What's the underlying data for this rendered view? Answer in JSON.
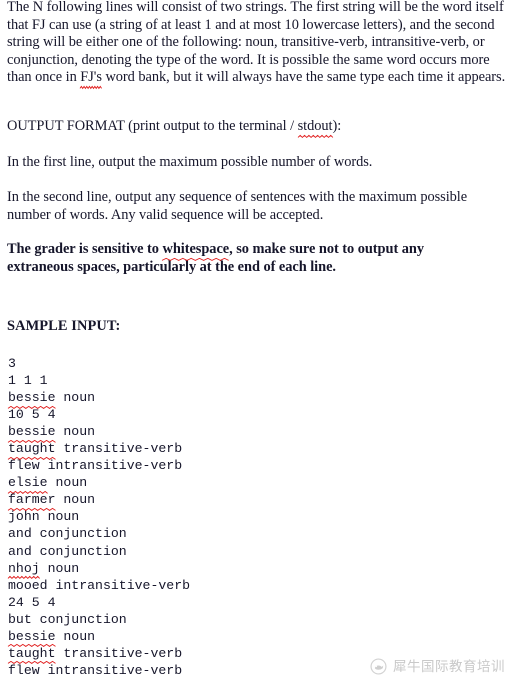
{
  "document": {
    "background_color": "#ffffff",
    "text_color": "#16162b",
    "spellcheck_underline_color": "#e01b1b"
  },
  "paragraphs": {
    "intro": {
      "part1": "The N following lines will consist of two strings.  The first string will be the word itself that FJ can use (a string of at least 1 and at most 10 lowercase letters), and the second string will be either one of the following: noun, transitive-verb, intransitive-verb, or conjunction, denoting the type of the word. It is possible the same word occurs more than once in ",
      "misspelled": "FJ's",
      "part2": " word bank, but it will always have the same type each time it appears."
    },
    "output_format": {
      "part1": "OUTPUT FORMAT (print output to the terminal / ",
      "misspelled": "stdout",
      "part2": "):"
    },
    "first_line": "In the first line, output the maximum possible number of words.",
    "second_line": "In the second line, output any sequence of sentences with the maximum possible number of words. Any valid sequence will be accepted.",
    "warning": {
      "part1": "The grader is sensitive to ",
      "misspelled": "whitespace",
      "part2": ", so make sure not to output any extraneous spaces, particularly at the end of each line."
    }
  },
  "headings": {
    "sample_input": "SAMPLE INPUT:"
  },
  "sample_input_lines": [
    "3",
    "1 1 1",
    "bessie noun",
    "10 5 4",
    "bessie noun",
    "taught transitive-verb",
    "flew intransitive-verb",
    "elsie noun",
    "farmer noun",
    "john noun",
    "and conjunction",
    "and conjunction",
    "nhoj noun",
    "mooed intransitive-verb",
    "24 5 4",
    "but conjunction",
    "bessie noun",
    "taught transitive-verb",
    "flew intransitive-verb"
  ],
  "sample_input_misspelled_line_indexes": [
    2,
    4,
    5,
    7,
    8,
    12,
    16,
    17
  ],
  "watermark": {
    "logo_icon": "rhino-circle-logo-icon",
    "text": "犀牛国际教育培训",
    "color": "#c9c9c9"
  }
}
